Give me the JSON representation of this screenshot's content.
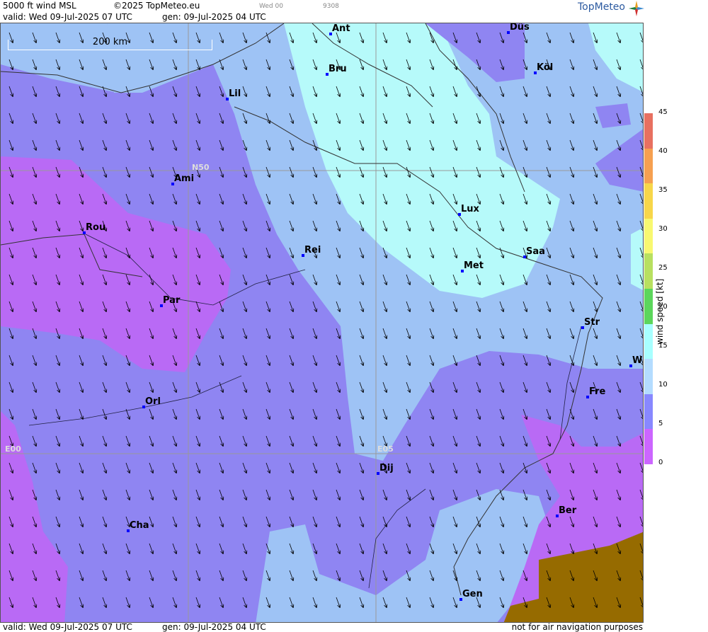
{
  "header": {
    "product": "5000 ft wind MSL",
    "copyright": "©2025 TopMeteo.eu",
    "small1": "Wed 00",
    "small2": "9308",
    "valid": "valid:  Wed  09-Jul-2025  07 UTC",
    "gen": "gen: 09-Jul-2025 04 UTC"
  },
  "logo": "TopMeteo",
  "scale": "200 km",
  "grid_labels": {
    "n50": "N50",
    "e00": "E00",
    "e05": "E05"
  },
  "cities": [
    "Ant",
    "Düs",
    "Bru",
    "Köl",
    "Lil",
    "Ami",
    "Rou",
    "Rei",
    "Lux",
    "Saa",
    "Met",
    "Par",
    "Str",
    "W",
    "Fre",
    "Orl",
    "Dij",
    "Ber",
    "Cha",
    "Gen"
  ],
  "legend": {
    "title": "wind  speed  [kt]",
    "ticks": [
      "45",
      "40",
      "35",
      "30",
      "25",
      "20",
      "15",
      "10",
      "5",
      "0"
    ],
    "colors": [
      "#e87060",
      "#f6a050",
      "#f7d64a",
      "#f8f870",
      "#b8e060",
      "#5cd65c",
      "#a8ffff",
      "#b4dcff",
      "#8888ff",
      "#cc66ff"
    ]
  },
  "footer": {
    "valid": "valid:  Wed  09-Jul-2025  07 UTC",
    "gen": "gen: 09-Jul-2025 04 UTC",
    "note": "not for air navigation purposes"
  },
  "colors": {
    "speed_0_5": "#b96af5",
    "speed_5_10": "#8f85f2",
    "speed_10_15": "#9ec3f5",
    "speed_15_20": "#b6fafa",
    "terrain": "#966b00"
  }
}
